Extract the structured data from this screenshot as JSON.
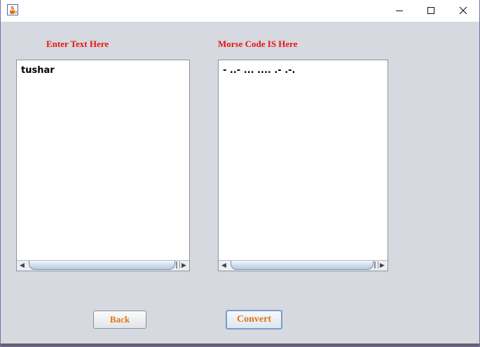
{
  "window": {
    "app_icon": "java-coffee-cup-icon",
    "controls": {
      "minimize_icon": "minimize-icon",
      "maximize_icon": "maximize-icon",
      "close_icon": "close-icon"
    }
  },
  "input_panel": {
    "label": "Enter Text Here",
    "value": "tushar"
  },
  "output_panel": {
    "label": "Morse Code IS Here",
    "value": "- ..- ... .... .- .-."
  },
  "buttons": {
    "back_label": "Back",
    "convert_label": "Convert"
  },
  "colors": {
    "label_color": "#e8140f",
    "button_text_color": "#e27412",
    "window_background": "#d6d9df"
  }
}
